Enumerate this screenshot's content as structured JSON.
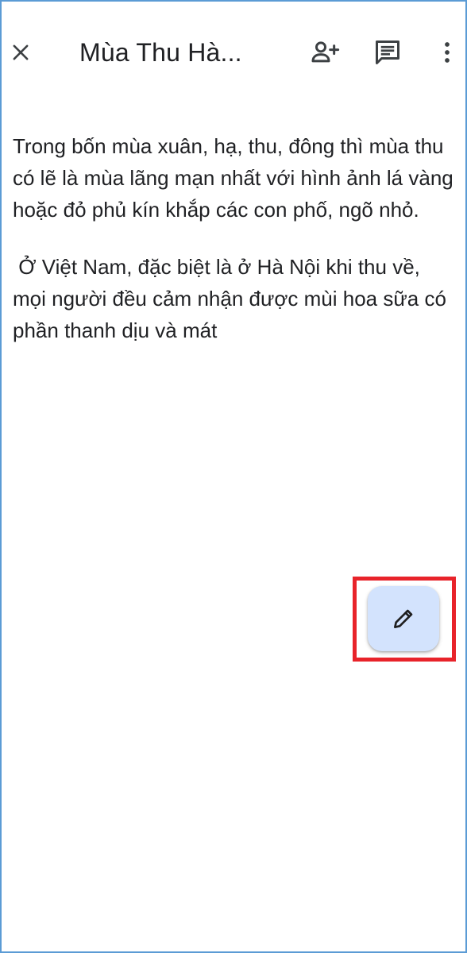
{
  "toolbar": {
    "title": "Mùa Thu Hà...",
    "close_icon": "close-icon",
    "add_person_icon": "add-person-icon",
    "comment_icon": "comment-icon",
    "more_icon": "more-vertical-icon"
  },
  "document": {
    "paragraphs": [
      "Trong bốn mùa xuân, hạ, thu, đông thì mùa thu có lẽ là mùa lãng mạn nhất với hình ảnh lá vàng hoặc đỏ phủ kín khắp các con phố, ngõ nhỏ.",
      " Ở Việt Nam, đặc biệt là ở Hà Nội khi thu về, mọi người đều cảm nhận được mùi hoa sữa có phần thanh dịu và mát"
    ]
  },
  "fab": {
    "icon": "pencil-edit-icon",
    "background": "#d3e3fd"
  },
  "colors": {
    "highlight_border": "#e8232a",
    "frame_border": "#5b9bd5",
    "text": "#202124"
  }
}
